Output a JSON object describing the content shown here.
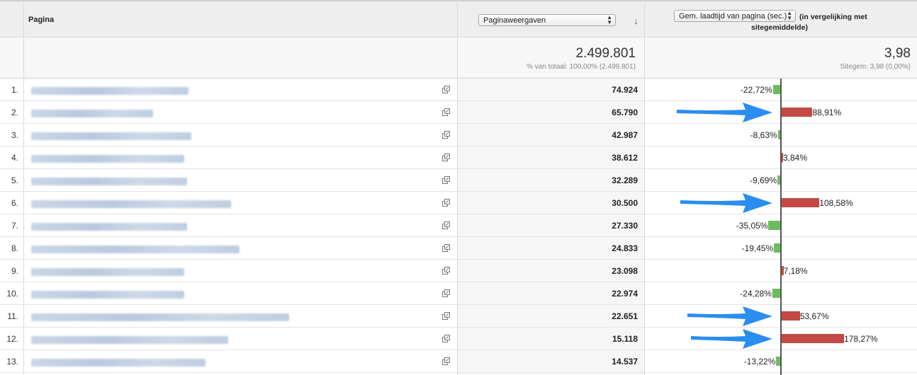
{
  "header": {
    "page_column": "Pagina",
    "metric_select": "Paginaweergaven",
    "compare_select": "Gem. laadtijd van pagina (sec.)",
    "compare_text_1": "(in vergelijking met",
    "compare_text_2": "sitegemiddelde)",
    "sort_icon": "arrow-down-icon"
  },
  "totals": {
    "pageviews": "2.499.801",
    "pageviews_sub": "% van totaal: 100,00% (2.499.801)",
    "loadtime": "3,98",
    "loadtime_sub": "Sitegem: 3,98 (0,00%)"
  },
  "colors": {
    "positive_bar": "#c34a44",
    "negative_bar": "#6cbc5e",
    "arrow": "#2a8df0"
  },
  "rows": [
    {
      "num": "1.",
      "pageviews": "74.924",
      "pct": "-22,72%",
      "value": -22.72
    },
    {
      "num": "2.",
      "pageviews": "65.790",
      "pct": "88,91%",
      "value": 88.91
    },
    {
      "num": "3.",
      "pageviews": "42.987",
      "pct": "-8,63%",
      "value": -8.63
    },
    {
      "num": "4.",
      "pageviews": "38.612",
      "pct": "3,84%",
      "value": 3.84
    },
    {
      "num": "5.",
      "pageviews": "32.289",
      "pct": "-9,69%",
      "value": -9.69
    },
    {
      "num": "6.",
      "pageviews": "30.500",
      "pct": "108,58%",
      "value": 108.58
    },
    {
      "num": "7.",
      "pageviews": "27.330",
      "pct": "-35,05%",
      "value": -35.05
    },
    {
      "num": "8.",
      "pageviews": "24.833",
      "pct": "-19,45%",
      "value": -19.45
    },
    {
      "num": "9.",
      "pageviews": "23.098",
      "pct": "7,18%",
      "value": 7.18
    },
    {
      "num": "10.",
      "pageviews": "22.974",
      "pct": "-24,28%",
      "value": -24.28
    },
    {
      "num": "11.",
      "pageviews": "22.651",
      "pct": "53,67%",
      "value": 53.67
    },
    {
      "num": "12.",
      "pageviews": "15.118",
      "pct": "178,27%",
      "value": 178.27
    },
    {
      "num": "13.",
      "pageviews": "14.537",
      "pct": "-13,22%",
      "value": -13.22
    }
  ]
}
